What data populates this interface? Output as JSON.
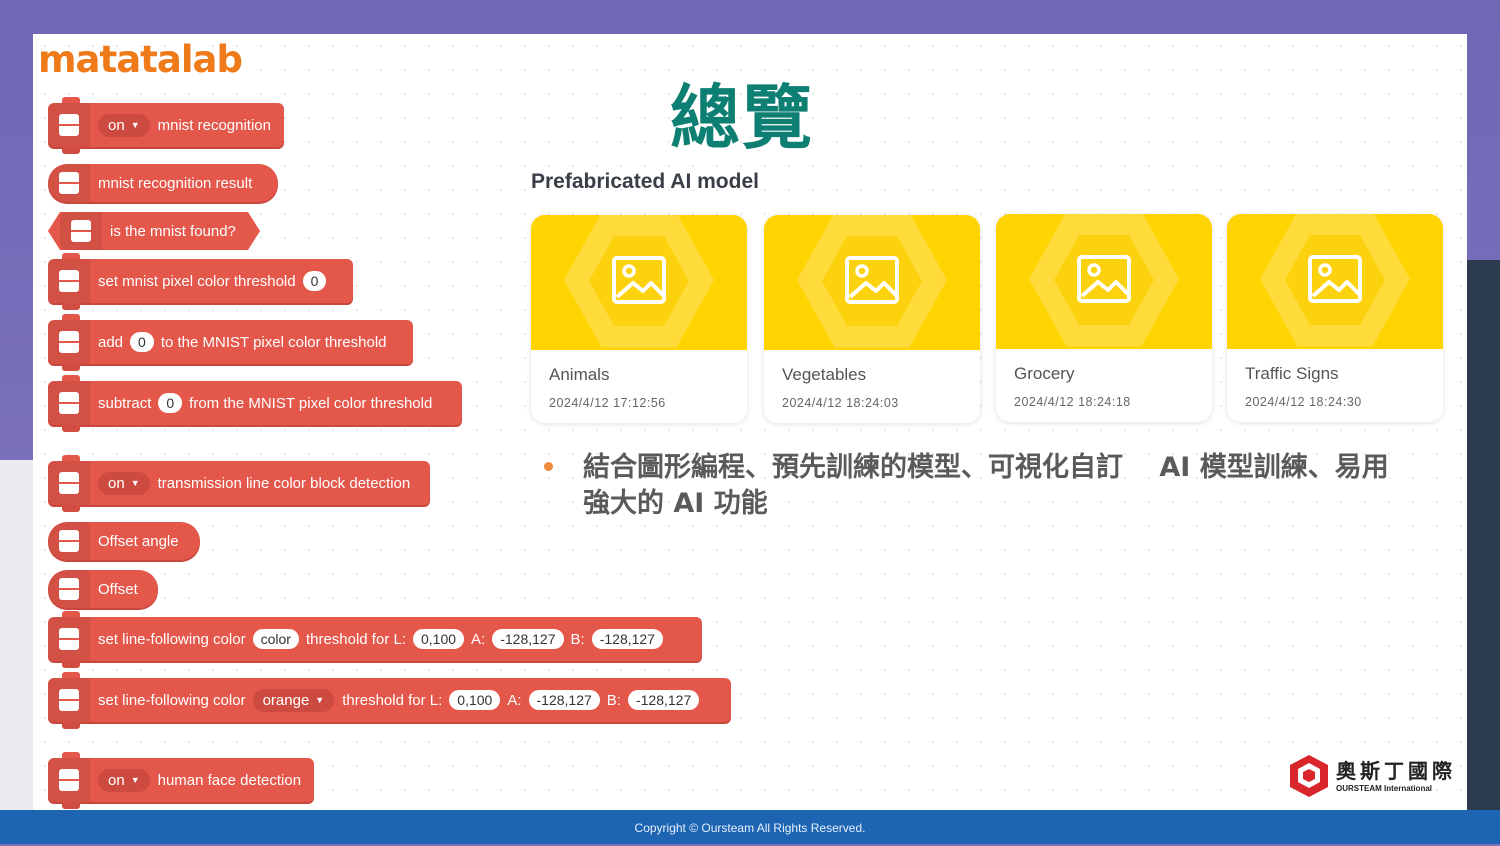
{
  "brand": {
    "logo_text": "matatalab",
    "footer_copyright": "Copyright © Oursteam All Rights Reserved.",
    "company_cn": "奧斯丁國際",
    "company_en": "OURSTEAM International"
  },
  "page": {
    "title": "總覽",
    "subtitle": "Prefabricated AI model"
  },
  "blocks": {
    "mnist_recognition": {
      "dropdown": "on",
      "text": "mnist recognition"
    },
    "mnist_result": {
      "text": "mnist recognition result"
    },
    "mnist_found": {
      "text": "is the mnist found?"
    },
    "set_threshold": {
      "text": "set mnist pixel color threshold",
      "value": "0"
    },
    "add_threshold": {
      "pre": "add",
      "value": "0",
      "post": "to the MNIST pixel color threshold"
    },
    "subtract_threshold": {
      "pre": "subtract",
      "value": "0",
      "post": "from the MNIST pixel color threshold"
    },
    "transmission": {
      "dropdown": "on",
      "text": "transmission line color block detection"
    },
    "offset_angle": {
      "text": "Offset angle"
    },
    "offset": {
      "text": "Offset"
    },
    "line_color_1": {
      "pre": "set line-following color",
      "color": "color",
      "mid": "threshold for L:",
      "l": "0,100",
      "a_label": "A:",
      "a": "-128,127",
      "b_label": "B:",
      "b": "-128,127"
    },
    "line_color_2": {
      "pre": "set line-following color",
      "color": "orange",
      "mid": "threshold for L:",
      "l": "0,100",
      "a_label": "A:",
      "a": "-128,127",
      "b_label": "B:",
      "b": "-128,127"
    },
    "face_detection": {
      "dropdown": "on",
      "text": "human face detection"
    }
  },
  "models": [
    {
      "name": "Animals",
      "date": "2024/4/12 17:12:56",
      "icon": "image-icon"
    },
    {
      "name": "Vegetables",
      "date": "2024/4/12 18:24:03",
      "icon": "image-icon"
    },
    {
      "name": "Grocery",
      "date": "2024/4/12 18:24:18",
      "icon": "image-icon"
    },
    {
      "name": "Traffic Signs",
      "date": "2024/4/12 18:24:30",
      "icon": "image-icon"
    }
  ],
  "bullet": {
    "line1": "結合圖形編程、預先訓練的模型、可視化自訂　 AI 模型訓練、易用",
    "line2": "強大的 AI 功能"
  },
  "colors": {
    "block": "#e4574b",
    "title": "#0d7f73",
    "card_thumb": "#ffd400",
    "footer": "#1d64b3",
    "logo": "#ef7a1a"
  }
}
